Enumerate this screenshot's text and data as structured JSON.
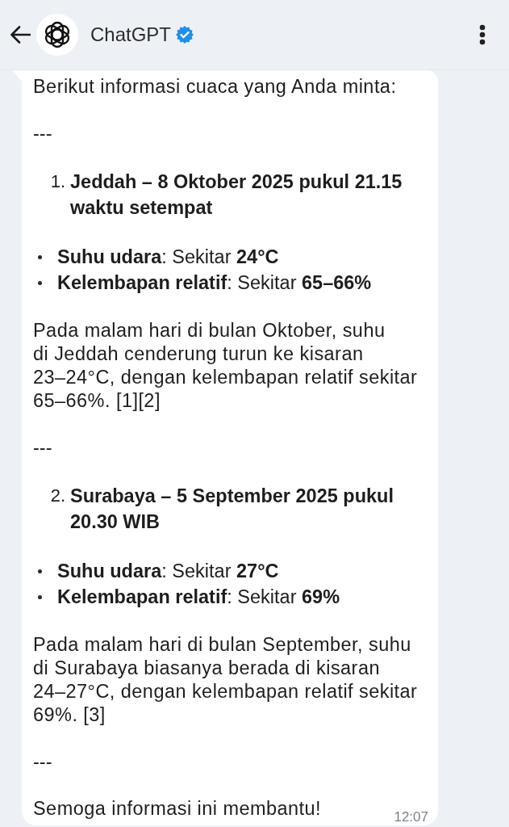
{
  "header": {
    "title": "ChatGPT",
    "verified": true
  },
  "message": {
    "blocks": [
      {
        "kind": "paragraph",
        "lines": [
          "Berikut informasi cuaca yang Anda minta:"
        ]
      },
      {
        "kind": "separator",
        "text": "---"
      },
      {
        "kind": "numbered",
        "number": "1.",
        "lines": [
          "Jeddah – 8 Oktober 2025 pukul 21.15",
          "waktu setempat"
        ]
      },
      {
        "kind": "bullets",
        "items": [
          "**Suhu udara**: Sekitar **24°C**",
          "**Kelembapan relatif**: Sekitar **65–66%**"
        ]
      },
      {
        "kind": "paragraph",
        "lines": [
          "Pada malam hari di bulan Oktober, suhu",
          "di Jeddah cenderung turun ke kisaran",
          "23–24°C, dengan kelembapan relatif sekitar",
          "65–66%. [1][2]"
        ]
      },
      {
        "kind": "separator",
        "text": "---"
      },
      {
        "kind": "numbered",
        "number": "2.",
        "lines": [
          "Surabaya – 5 September 2025 pukul",
          "20.30 WIB"
        ]
      },
      {
        "kind": "bullets",
        "items": [
          "**Suhu udara**: Sekitar **27°C**",
          "**Kelembapan relatif**: Sekitar **69%**"
        ]
      },
      {
        "kind": "paragraph",
        "lines": [
          "Pada malam hari di bulan September, suhu",
          "di Surabaya biasanya berada di kisaran",
          "24–27°C, dengan kelembapan relatif sekitar",
          "69%. [3]"
        ]
      },
      {
        "kind": "separator",
        "text": "---"
      },
      {
        "kind": "paragraph",
        "lines": [
          "Semoga informasi ini membantu!"
        ]
      }
    ],
    "time": "12:07"
  }
}
